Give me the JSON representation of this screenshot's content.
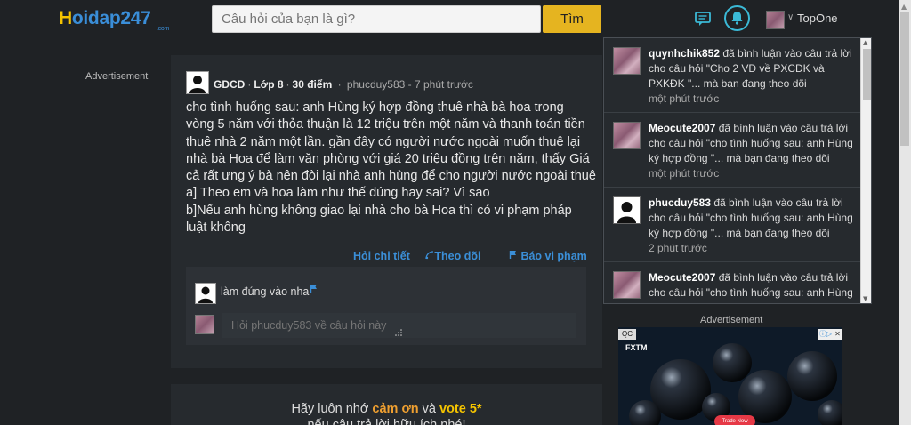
{
  "header": {
    "logo_main": "oidap247",
    "logo_first": "H",
    "logo_suffix": ".com",
    "search_placeholder": "Câu hỏi của bạn là gì?",
    "search_button": "Tìm",
    "username": "TopOne"
  },
  "left_ad_label": "Advertisement",
  "question": {
    "subject": "GDCD",
    "grade": "Lớp 8",
    "points": "30 điểm",
    "author_time": "phucduy583 - 7 phút trước",
    "body_lines": [
      "cho tình huống sau: anh Hùng ký hợp đồng thuê nhà bà hoa trong",
      "vòng 5 năm với thỏa thuận là 12 triệu trên một năm và thanh toán tiền",
      "thuê nhà 2 năm một lần. gần đây có người nước ngoài muốn thuê lại",
      "nhà bà Hoa để làm văn phòng với giá 20 triệu đồng trên năm, thấy Giá",
      "cả rất ưng ý bà nên đòi lại nhà anh hùng để cho người nước ngoài thuê",
      "a] Theo em và hoa làm như thế đúng hay sai? Vì sao",
      "b]Nếu anh hùng không giao lại nhà cho bà Hoa thì có vi phạm pháp",
      "luật không"
    ],
    "actions": {
      "detail": "Hỏi chi tiết",
      "follow": "Theo dõi",
      "report": "Báo vi phạm"
    },
    "comment": "làm đúng vào nha",
    "comment_placeholder": "Hỏi phucduy583 về câu hỏi này"
  },
  "bottom_card": {
    "line1_a": "Hãy luôn nhớ ",
    "line1_thanks": "cảm ơn",
    "line1_b": " và ",
    "line1_vote": "vote 5*",
    "line2": "nếu câu trả lời hữu ích nhé!"
  },
  "notifications": [
    {
      "user": "quynhchik852",
      "text": " đã bình luận vào câu trả lời cho câu hỏi \"Cho 2 VD về PXCĐK và PXKĐK \"... mà bạn đang theo dõi",
      "time": "một phút trước"
    },
    {
      "user": "Meocute2007",
      "text": " đã bình luận vào câu trả lời cho câu hỏi \"cho tình huống sau: anh Hùng ký hợp đồng \"... mà bạn đang theo dõi",
      "time": "một phút trước"
    },
    {
      "user": "phucduy583",
      "text": " đã bình luận vào câu trả lời cho câu hỏi \"cho tình huống sau: anh Hùng ký hợp đồng \"... mà bạn đang theo dõi",
      "time": "2 phút trước"
    },
    {
      "user": "Meocute2007",
      "text": " đã bình luận vào câu trả lời cho câu hỏi \"cho tình huống sau: anh Hùng",
      "time": ""
    }
  ],
  "right_ad": {
    "label": "Advertisement",
    "qc": "QC",
    "brand": "FXTM",
    "cta": "Trade Now"
  },
  "colors": {
    "background": "#1f2225",
    "card": "#262a2e",
    "accent_blue": "#3b8fd8",
    "search_button": "#e5b420"
  }
}
